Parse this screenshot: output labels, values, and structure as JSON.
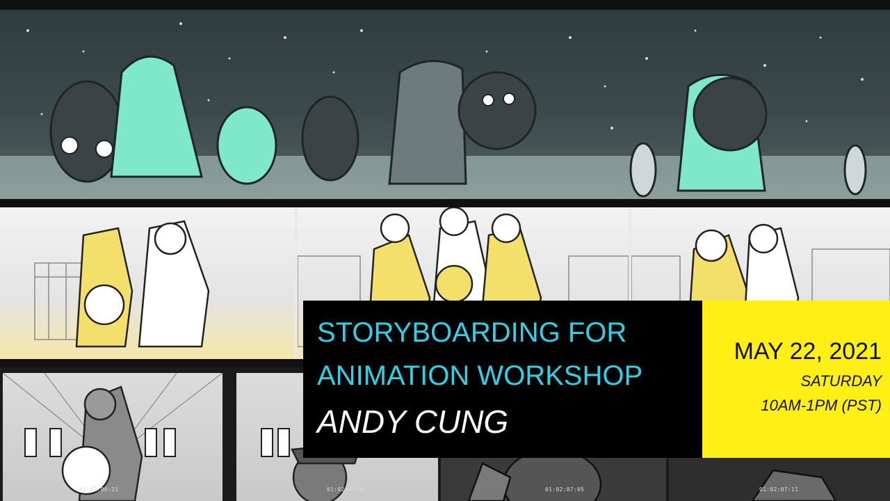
{
  "title": {
    "line1": "STORYBOARDING FOR",
    "line2": "ANIMATION WORKSHOP",
    "presenter": "ANDY CUNG"
  },
  "schedule": {
    "date": "MAY 22, 2021",
    "day": "SATURDAY",
    "time": "10AM-1PM (PST)"
  },
  "timecodes": [
    "01:02:06:21",
    "01:02:07:02",
    "01:02:07:05",
    "01:02:07:11"
  ],
  "colors": {
    "title_text": "#2ad4e8",
    "date_box": "#ffef14",
    "mint_highlight": "#7fe8c8",
    "yellow_highlight": "#f3e06a"
  }
}
